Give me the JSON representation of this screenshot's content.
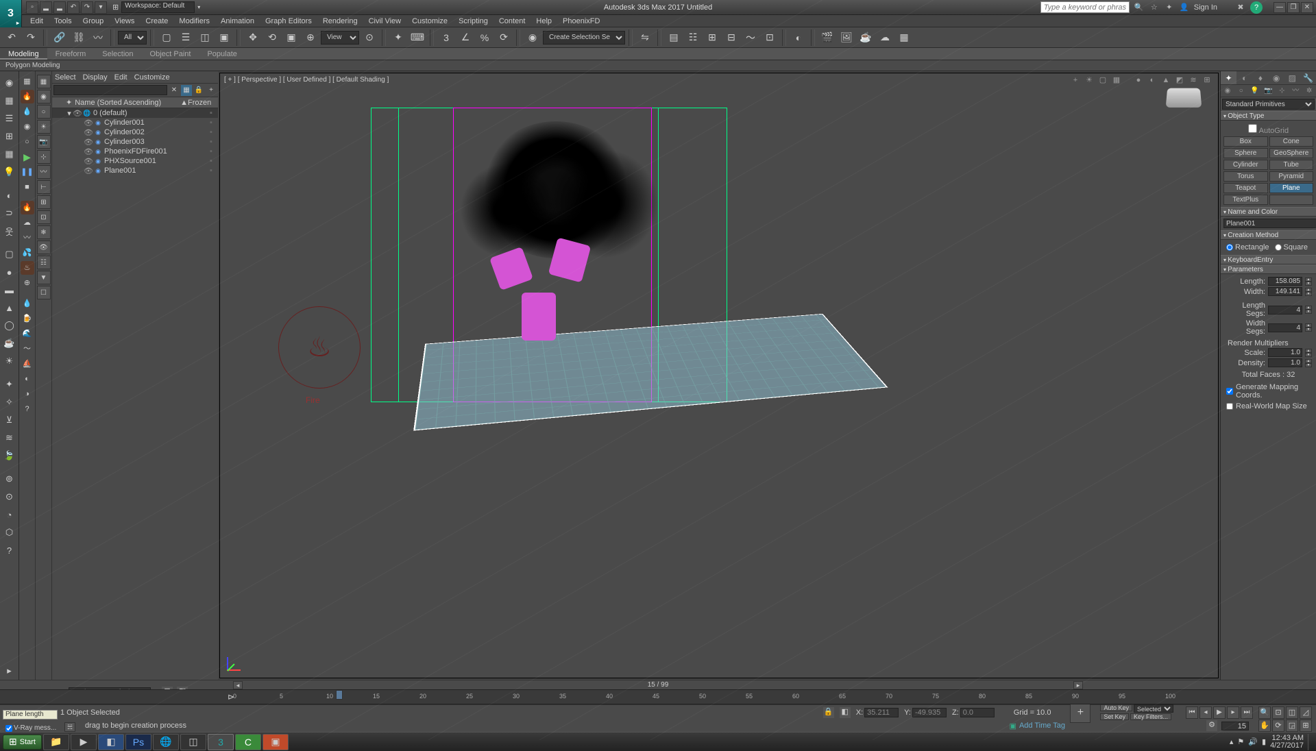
{
  "titlebar": {
    "workspace_label": "Workspace: Default",
    "app_title": "Autodesk 3ds Max 2017   Untitled",
    "search_placeholder": "Type a keyword or phrase",
    "signin": "Sign In"
  },
  "menus": [
    "Edit",
    "Tools",
    "Group",
    "Views",
    "Create",
    "Modifiers",
    "Animation",
    "Graph Editors",
    "Rendering",
    "Civil View",
    "Customize",
    "Scripting",
    "Content",
    "Help",
    "PhoenixFD"
  ],
  "maintb": {
    "filter_all": "All",
    "create_sel_set": "Create Selection Se"
  },
  "ribbon": {
    "tabs": [
      "Modeling",
      "Freeform",
      "Selection",
      "Object Paint",
      "Populate"
    ],
    "sub": "Polygon Modeling"
  },
  "scene": {
    "menu": [
      "Select",
      "Display",
      "Edit",
      "Customize"
    ],
    "col_name": "Name (Sorted Ascending)",
    "col_frozen": "Frozen",
    "root": "0 (default)",
    "items": [
      {
        "name": "Cylinder001"
      },
      {
        "name": "Cylinder002"
      },
      {
        "name": "Cylinder003"
      },
      {
        "name": "PhoenixFDFire001"
      },
      {
        "name": "PHXSource001"
      },
      {
        "name": "Plane001"
      }
    ]
  },
  "viewport": {
    "label": "[ + ] [ Perspective ] [ User Defined ] [ Default Shading ]",
    "fire_label": "Fire"
  },
  "timeline": {
    "frame_display": "15 / 99",
    "ticks": [
      0,
      5,
      10,
      15,
      20,
      25,
      30,
      35,
      40,
      45,
      50,
      55,
      60,
      65,
      70,
      75,
      80,
      85,
      90,
      95,
      100
    ],
    "current": 15
  },
  "workspace_row": {
    "label": "Workspace: Default"
  },
  "cmdpanel": {
    "dropdown": "Standard Primitives",
    "object_type": "Object Type",
    "autogrid": "AutoGrid",
    "prims": [
      "Box",
      "Cone",
      "Sphere",
      "GeoSphere",
      "Cylinder",
      "Tube",
      "Torus",
      "Pyramid",
      "Teapot",
      "Plane",
      "TextPlus",
      ""
    ],
    "active_prim": "Plane",
    "name_color": "Name and Color",
    "obj_name": "Plane001",
    "creation": "Creation Method",
    "cm_rect": "Rectangle",
    "cm_square": "Square",
    "kbentry": "KeyboardEntry",
    "params": "Parameters",
    "length_lbl": "Length:",
    "length_val": "158.085",
    "width_lbl": "Width:",
    "width_val": "149.141",
    "lsegs_lbl": "Length Segs:",
    "lsegs_val": "4",
    "wsegs_lbl": "Width Segs:",
    "wsegs_val": "4",
    "render_mult": "Render Multipliers",
    "scale_lbl": "Scale:",
    "scale_val": "1.0",
    "density_lbl": "Density:",
    "density_val": "1.0",
    "faces_lbl": "Total Faces : 32",
    "genmap": "Generate Mapping Coords.",
    "realworld": "Real-World Map Size"
  },
  "status": {
    "sel": "1 Object Selected",
    "plane_len": "Plane length",
    "vray": "V-Ray mess...",
    "prompt": "drag to begin creation process",
    "x": "X:",
    "xv": "35.211",
    "y": "Y:",
    "yv": "-49.935",
    "z": "Z:",
    "zv": "0.0",
    "grid": "Grid = 10.0",
    "autokey": "Auto Key",
    "setkey": "Set Key",
    "selected": "Selected",
    "keyfilters": "Key Filters...",
    "addtag": "Add Time Tag",
    "frame": "15"
  },
  "taskbar": {
    "start": "Start",
    "time": "12:43 AM",
    "date": "4/27/2017"
  }
}
